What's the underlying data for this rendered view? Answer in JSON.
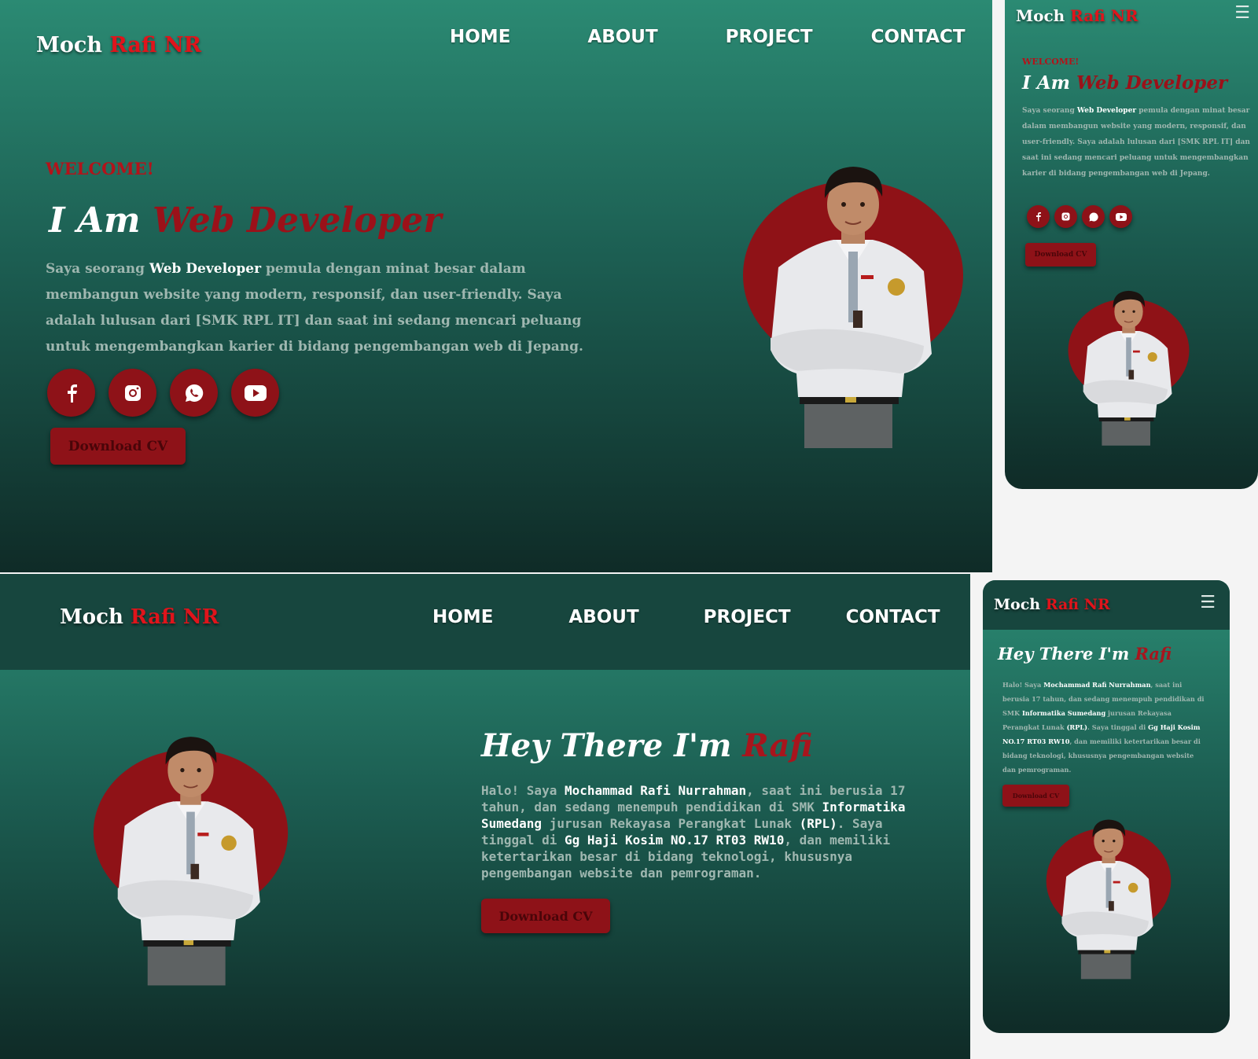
{
  "brand": {
    "first": "Moch",
    "accent": "Rafi NR"
  },
  "nav": [
    "HOME",
    "ABOUT",
    "PROJECT",
    "CONTACT"
  ],
  "home": {
    "welcome": "WELCOME!",
    "headline_plain": "I Am",
    "headline_accent": "Web Developer",
    "bio_pre": "Saya seorang",
    "bio_bold": "Web Developer",
    "bio_post": "pemula dengan minat besar dalam membangun website yang modern, responsif, dan user-friendly. Saya adalah lulusan dari [SMK RPL IT] dan saat ini sedang mencari peluang untuk mengembangkan karier di bidang pengembangan web di Jepang.",
    "socials": [
      "facebook-icon",
      "instagram-icon",
      "whatsapp-icon",
      "youtube-icon"
    ],
    "cv_label": "Download CV"
  },
  "about": {
    "headline_plain": "Hey There I'm",
    "headline_accent": "Rafi",
    "bio_1": "Halo! Saya",
    "bio_name": "Mochammad Rafi Nurrahman",
    "bio_2": ", saat ini berusia 17 tahun, dan sedang menempuh pendidikan di SMK",
    "bio_school": "Informatika Sumedang",
    "bio_3": "jurusan Rekayasa Perangkat Lunak",
    "bio_rpl": "(RPL)",
    "bio_4": ". Saya tinggal di",
    "bio_address": "Gg Haji Kosim NO.17 RT03 RW10",
    "bio_5": ", dan memiliki ketertarikan besar di bidang teknologi, khususnya pengembangan website dan pemrograman.",
    "cv_label": "Download CV"
  },
  "mobile": {
    "menu_icon": "☰"
  },
  "colors": {
    "accent_red": "#9b1119",
    "bg_top": "#2b8a73",
    "bg_bottom": "#0f2b27",
    "header": "#17463e"
  }
}
